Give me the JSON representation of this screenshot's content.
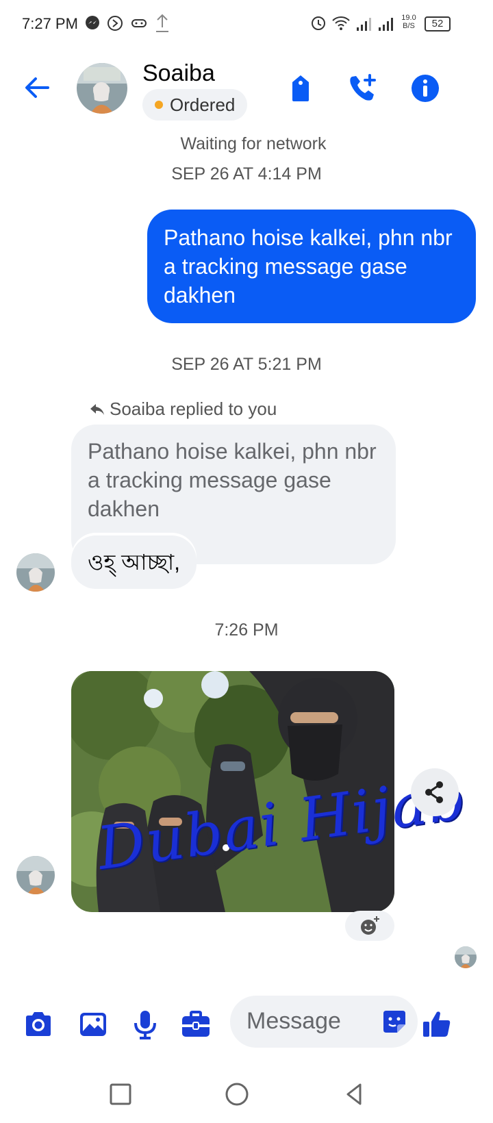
{
  "status_bar": {
    "time": "7:27 PM",
    "speed_value": "19.0",
    "speed_unit": "B/S",
    "battery": "52"
  },
  "header": {
    "contact_name": "Soaiba",
    "label": "Ordered"
  },
  "conversation": {
    "network_status": "Waiting for network",
    "timestamp_1": "SEP 26 AT 4:14 PM",
    "outgoing_message": "Pathano hoise kalkei, phn nbr a tracking message gase dakhen",
    "timestamp_2": "SEP 26 AT 5:21 PM",
    "reply_meta": "Soaiba replied to you",
    "quoted_message": "Pathano hoise kalkei, phn nbr a tracking message gase dakhen",
    "incoming_message": "ওহ্ আচ্ছা,",
    "timestamp_3": "7:26 PM",
    "photo_watermark": "Dubai Hijab"
  },
  "composer": {
    "placeholder": "Message"
  },
  "colors": {
    "accent": "#0a5cf5",
    "icon_blue": "#1a3fd6",
    "bubble_in": "#f0f2f5",
    "label_dot": "#f5a623"
  },
  "icons": [
    "back-arrow-icon",
    "tag-icon",
    "add-call-icon",
    "info-icon",
    "reply-icon",
    "share-icon",
    "add-reaction-icon",
    "camera-icon",
    "gallery-icon",
    "microphone-icon",
    "briefcase-icon",
    "sticker-icon",
    "thumbs-up-icon",
    "recent-apps-icon",
    "home-icon",
    "back-triangle-icon"
  ]
}
